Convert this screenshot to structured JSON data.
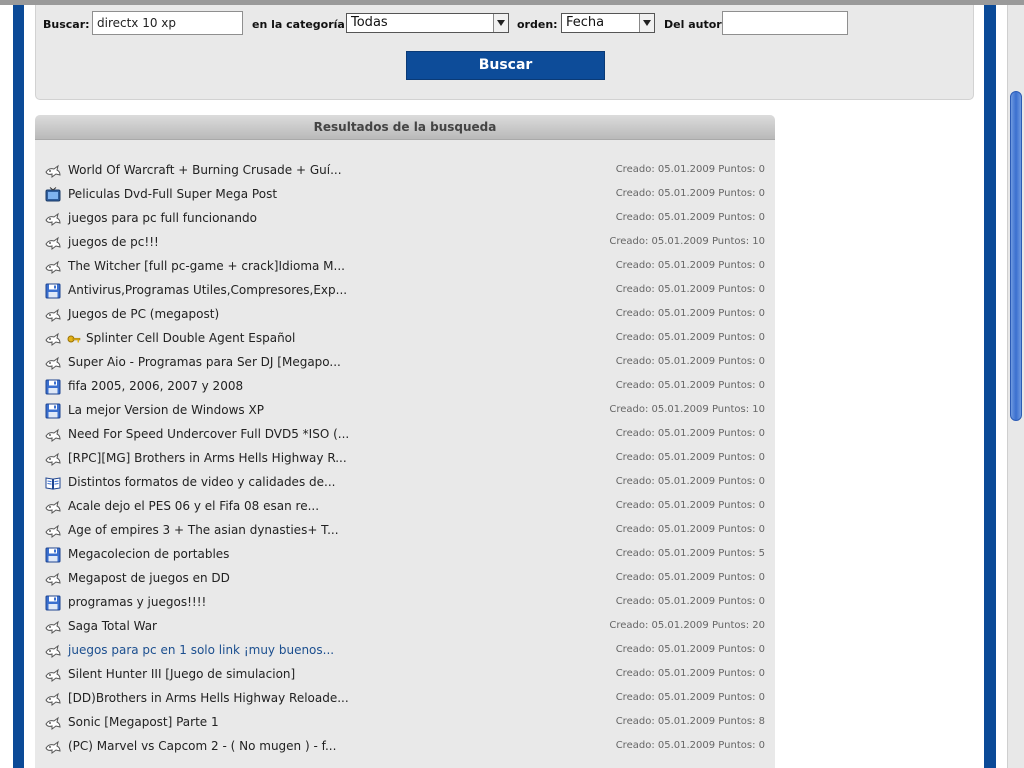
{
  "search": {
    "buscar_label": "Buscar:",
    "query_value": "directx 10 xp",
    "categoria_label": "en la categoría:",
    "categoria_value": "Todas",
    "orden_label": "orden:",
    "orden_value": "Fecha",
    "autor_label": "Del autor:",
    "autor_value": "",
    "button_label": "Buscar"
  },
  "results": {
    "header": "Resultados de la busqueda",
    "rows": [
      {
        "icon": "dove-icon",
        "title": "World Of Warcraft + Burning Crusade + Guí...",
        "meta": "Creado: 05.01.2009 Puntos: 0"
      },
      {
        "icon": "tv-icon",
        "title": "Peliculas Dvd-Full Super Mega Post",
        "meta": "Creado: 05.01.2009 Puntos: 0"
      },
      {
        "icon": "dove-icon",
        "title": "juegos para pc full funcionando",
        "meta": "Creado: 05.01.2009 Puntos: 0"
      },
      {
        "icon": "dove-icon",
        "title": "juegos de pc!!!",
        "meta": "Creado: 05.01.2009 Puntos: 10"
      },
      {
        "icon": "dove-icon",
        "title": "The Witcher [full pc-game + crack]Idioma M...",
        "meta": "Creado: 05.01.2009 Puntos: 0"
      },
      {
        "icon": "floppy-icon",
        "title": "Antivirus,Programas Utiles,Compresores,Exp...",
        "meta": "Creado: 05.01.2009 Puntos: 0"
      },
      {
        "icon": "dove-icon",
        "title": "Juegos de PC (megapost)",
        "meta": "Creado: 05.01.2009 Puntos: 0"
      },
      {
        "icon": "dove-icon",
        "key": true,
        "title": "Splinter Cell Double Agent Español",
        "meta": "Creado: 05.01.2009 Puntos: 0"
      },
      {
        "icon": "dove-icon",
        "title": "Super Aio - Programas para Ser DJ [Megapo...",
        "meta": "Creado: 05.01.2009 Puntos: 0"
      },
      {
        "icon": "floppy-icon",
        "title": "fifa 2005, 2006, 2007 y 2008",
        "meta": "Creado: 05.01.2009 Puntos: 0"
      },
      {
        "icon": "floppy-icon",
        "title": "La mejor Version de Windows XP",
        "meta": "Creado: 05.01.2009 Puntos: 10"
      },
      {
        "icon": "dove-icon",
        "title": "Need For Speed Undercover Full DVD5 *ISO (...",
        "meta": "Creado: 05.01.2009 Puntos: 0"
      },
      {
        "icon": "dove-icon",
        "title": "[RPC][MG] Brothers in Arms Hells Highway R...",
        "meta": "Creado: 05.01.2009 Puntos: 0"
      },
      {
        "icon": "book-icon",
        "title": "Distintos formatos de video y calidades de...",
        "meta": "Creado: 05.01.2009 Puntos: 0"
      },
      {
        "icon": "dove-icon",
        "title": "Acale dejo el PES 06 y el Fifa 08 esan re...",
        "meta": "Creado: 05.01.2009 Puntos: 0"
      },
      {
        "icon": "dove-icon",
        "title": "Age of empires 3 + The asian dynasties+ T...",
        "meta": "Creado: 05.01.2009 Puntos: 0"
      },
      {
        "icon": "floppy-icon",
        "title": "Megacolecion de portables",
        "meta": "Creado: 05.01.2009 Puntos: 5"
      },
      {
        "icon": "dove-icon",
        "title": "Megapost de juegos en DD",
        "meta": "Creado: 05.01.2009 Puntos: 0"
      },
      {
        "icon": "floppy-icon",
        "title": "programas y juegos!!!!",
        "meta": "Creado: 05.01.2009 Puntos: 0"
      },
      {
        "icon": "dove-icon",
        "title": "Saga Total War",
        "meta": "Creado: 05.01.2009 Puntos: 20"
      },
      {
        "icon": "dove-icon",
        "link": true,
        "title": "juegos para pc en 1 solo link ¡muy buenos...",
        "meta": "Creado: 05.01.2009 Puntos: 0"
      },
      {
        "icon": "dove-icon",
        "title": "Silent Hunter III [Juego de simulacion]",
        "meta": "Creado: 05.01.2009 Puntos: 0"
      },
      {
        "icon": "dove-icon",
        "title": "[DD)Brothers in Arms Hells Highway Reloade...",
        "meta": "Creado: 05.01.2009 Puntos: 0"
      },
      {
        "icon": "dove-icon",
        "title": "Sonic [Megapost] Parte 1",
        "meta": "Creado: 05.01.2009 Puntos: 8"
      },
      {
        "icon": "dove-icon",
        "title": "(PC) Marvel vs Capcom 2 - ( No mugen ) - f...",
        "meta": "Creado: 05.01.2009 Puntos: 0"
      }
    ]
  }
}
